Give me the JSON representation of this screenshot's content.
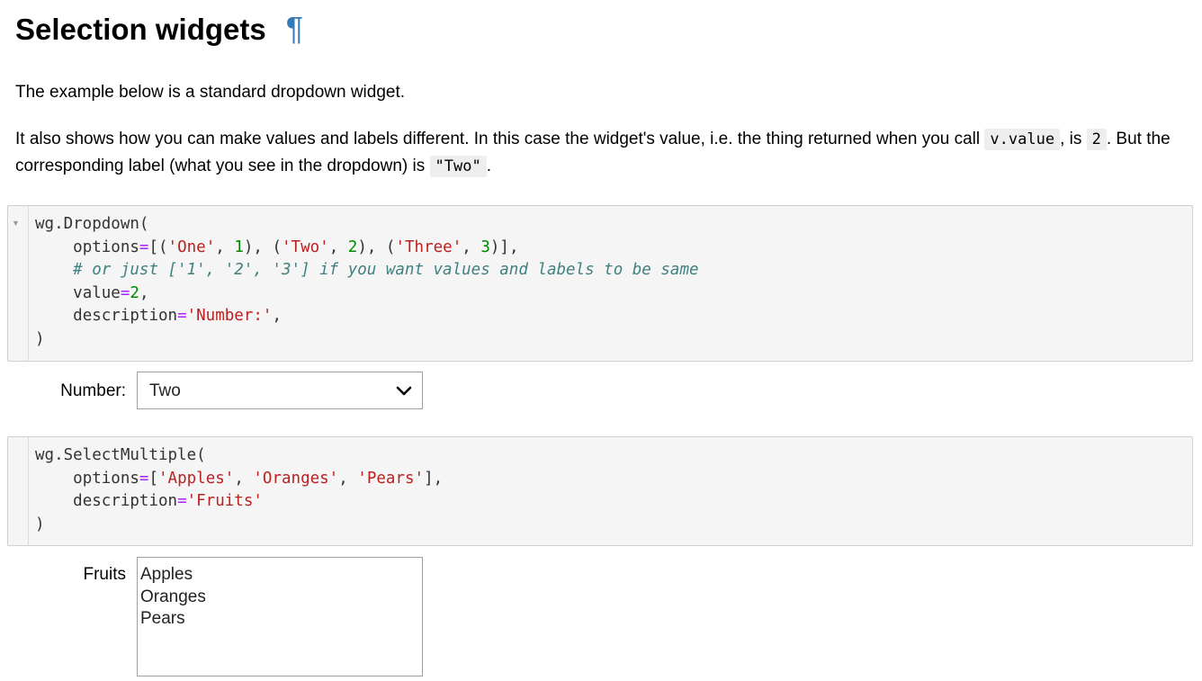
{
  "heading": {
    "title": "Selection widgets",
    "anchor": "¶"
  },
  "intro": {
    "p1": "The example below is a standard dropdown widget.",
    "p2_a": "It also shows how you can make values and labels different. In this case the widget's value, i.e. the thing returned when you call ",
    "p2_code1": "v.value",
    "p2_b": ", is ",
    "p2_code2": "2",
    "p2_c": ". But the corresponding label (what you see in the dropdown) is ",
    "p2_code3": "\"Two\"",
    "p2_d": "."
  },
  "cell1": {
    "l1": "wg.Dropdown(",
    "options_key": "options",
    "eq": "=",
    "s_one": "'One'",
    "n_1": "1",
    "s_two": "'Two'",
    "n_2": "2",
    "s_three": "'Three'",
    "n_3": "3",
    "comment": "# or just ['1', '2', '3'] if you want values and labels to be same",
    "value_key": "value",
    "value_num": "2",
    "desc_key": "description",
    "desc_str": "'Number:'",
    "close": ")"
  },
  "dropdown": {
    "label": "Number:",
    "selected": "Two",
    "options": [
      "One",
      "Two",
      "Three"
    ]
  },
  "cell2": {
    "l1": "wg.SelectMultiple(",
    "options_key": "options",
    "eq": "=",
    "s_apples": "'Apples'",
    "s_oranges": "'Oranges'",
    "s_pears": "'Pears'",
    "desc_key": "description",
    "desc_str": "'Fruits'",
    "close": ")"
  },
  "select_multiple": {
    "label": "Fruits",
    "options": [
      "Apples",
      "Oranges",
      "Pears"
    ]
  },
  "icons": {
    "chevron": "chevron-down-icon",
    "collapse": "collapse-triangle-icon"
  },
  "colors": {
    "anchor": "#337ab7",
    "string": "#ba2121",
    "number": "#008800",
    "operator": "#aa22ff",
    "comment": "#408080"
  }
}
